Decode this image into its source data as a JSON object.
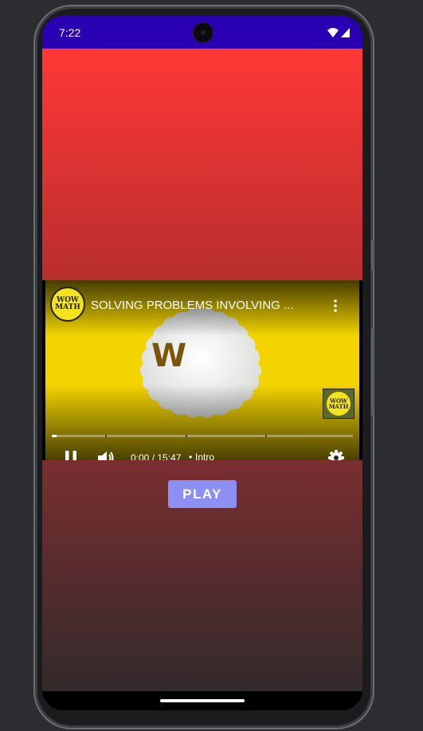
{
  "status_bar": {
    "time": "7:22",
    "icons": [
      "wifi-icon",
      "signal-icon"
    ]
  },
  "player": {
    "channel_logo_text": [
      "WOW",
      "MATH"
    ],
    "title": "SOLVING PROBLEMS INVOLVING ...",
    "thumbnail_letter": "W",
    "watermark_text": [
      "WOW",
      "MATH"
    ],
    "time_display": "0:00 / 15:47",
    "chapter_separator": "•",
    "chapter": "Intro",
    "progress": 0.015,
    "controls": [
      "pause-icon",
      "volume-icon",
      "settings-icon",
      "more-options-icon"
    ]
  },
  "play_button": {
    "label": "PLAY",
    "color": "#8c8ff4"
  },
  "colors": {
    "status_bar": "#2a00b3",
    "top_panel": "#ff3836",
    "video_background": "#f3d400"
  }
}
